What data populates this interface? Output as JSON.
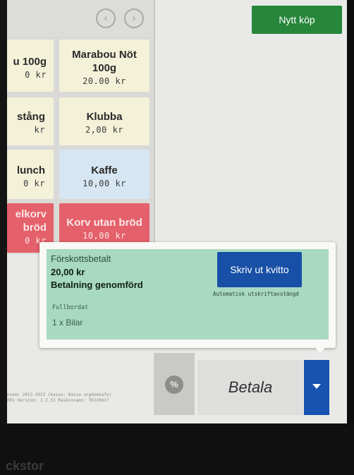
{
  "grid": {
    "nav_prev": "‹",
    "nav_next": "›",
    "tiles": [
      {
        "name": "u 100g",
        "price": "0 kr"
      },
      {
        "name": "Marabou Nöt 100g",
        "price": "20.00 kr"
      },
      {
        "name": "stång",
        "price": "kr"
      },
      {
        "name": "Klubba",
        "price": "2,00 kr"
      },
      {
        "name": "lunch",
        "price": "0 kr"
      },
      {
        "name": "Kaffe",
        "price": "10,00 kr"
      },
      {
        "name": "elkorv bröd",
        "price": "0 kr"
      },
      {
        "name": "Korv utan bröd",
        "price": "10,00 kr"
      }
    ]
  },
  "header": {
    "new_purchase": "Nytt köp"
  },
  "popup": {
    "title": "Förskottsbetalt",
    "amount": "20,00 kr",
    "status": "Betalning genomförd",
    "print_button": "Skriv ut kvitto",
    "auto_close_note": "Automatisk utskriftavstängd",
    "completed_label": "Fullbordat",
    "item": "1 x Bilar"
  },
  "footer": {
    "line1": "nsoec 2013-2022 (Kassa: Kassa ungdomsafe)",
    "line2": "001 Version: 2.2.53 Maskinnamn: TK32062?"
  },
  "actions": {
    "discount": "%",
    "pay": "Betala"
  },
  "bezel": {
    "brand": "ckstor"
  },
  "colors": {
    "accent_green": "#26863a",
    "accent_blue": "#1750a6",
    "popup_green": "#a8d9c1",
    "tile_red": "#e4606a"
  }
}
